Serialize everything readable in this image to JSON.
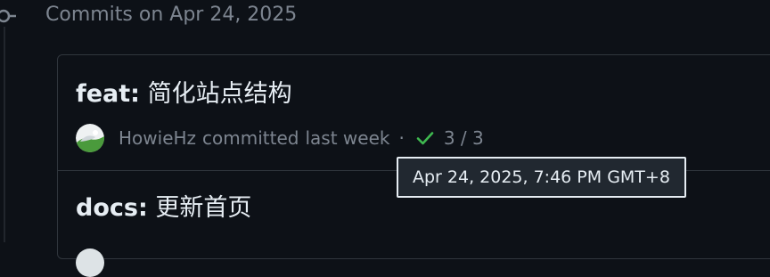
{
  "group": {
    "header": "Commits on Apr 24, 2025"
  },
  "commits": [
    {
      "prefix": "feat:",
      "message": " 简化站点结构",
      "author": "HowieHz",
      "action": "committed",
      "time": "last week",
      "separator": "·",
      "checks": "3 / 3",
      "check_color": "#3fb950"
    },
    {
      "prefix": "docs:",
      "message": " 更新首页"
    }
  ],
  "tooltip": {
    "text": "Apr 24, 2025, 7:46 PM GMT+8"
  },
  "icons": {
    "timeline": "git-commit-icon",
    "checks": "check-icon"
  },
  "colors": {
    "background": "#0d1117",
    "border": "#30363d",
    "muted": "#7d8590",
    "text": "#e6edf3",
    "success": "#3fb950"
  }
}
